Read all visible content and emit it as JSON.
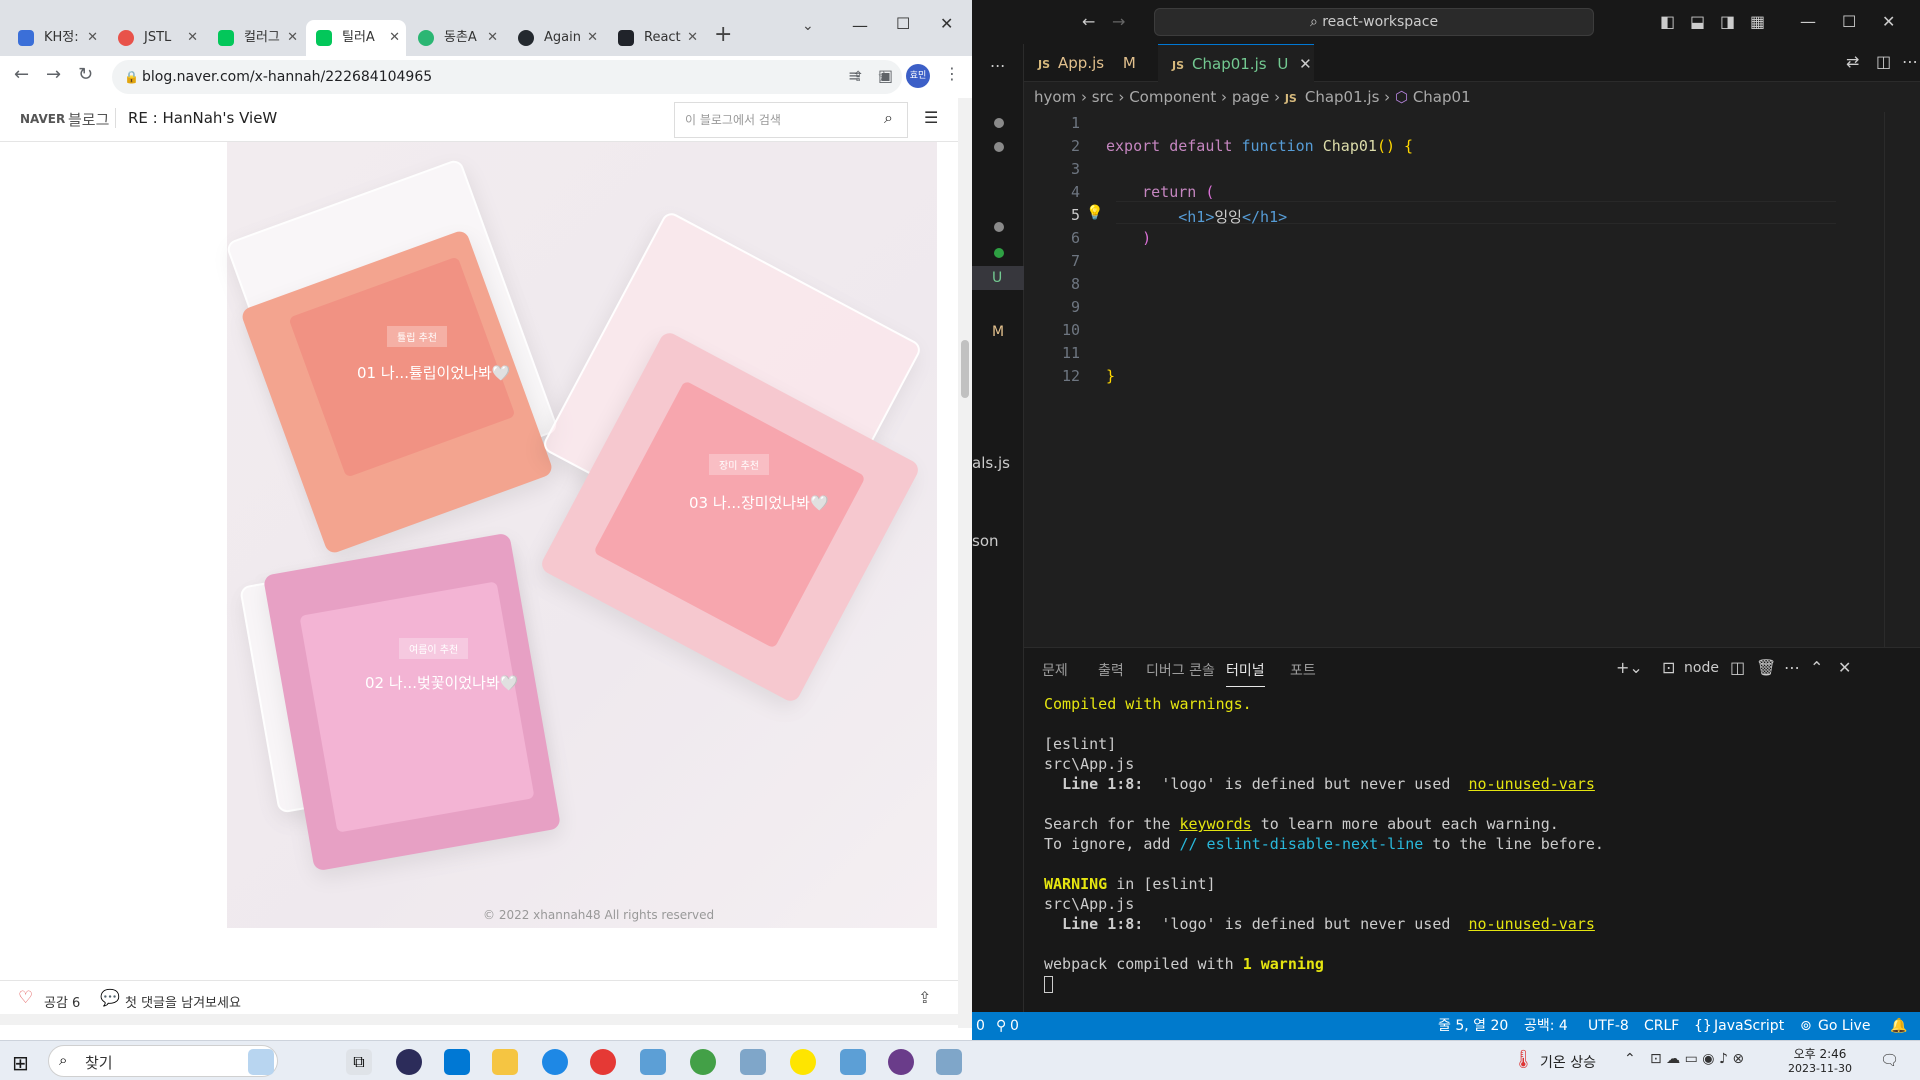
{
  "chrome": {
    "tabs": [
      {
        "label": "KH정:",
        "color": "#3b6fd8"
      },
      {
        "label": "JSTL",
        "color": "#e8524a"
      },
      {
        "label": "컬러그",
        "color": "#03c75a"
      },
      {
        "label": "틸러A",
        "color": "#03c75a"
      },
      {
        "label": "동촌A",
        "color": "#2bb673"
      },
      {
        "label": "Again",
        "color": "#24292f"
      },
      {
        "label": "React",
        "color": "#20232a"
      }
    ],
    "new_tab": "+",
    "url": "blog.naver.com/x-hannah/222684104965",
    "profile": "효민",
    "naver_logo": "NAVER",
    "blog_label": "블로그",
    "blog_title": "RE : HanNah's VieW",
    "search_placeholder": "이 블로그에서 검색",
    "photo": {
      "palette_1": {
        "badge": "튤립 추천",
        "title": "01 나...튤립이었나봐🤍"
      },
      "palette_2": {
        "badge": "여름이 추천",
        "title": "02 나...벚꽃이었나봐🤍"
      },
      "palette_3": {
        "badge": "장미 추천",
        "title": "03 나...장미었나봐🤍"
      },
      "copyright": "© 2022 xhannah48 All rights reserved"
    },
    "like_label": "공감 6",
    "comment_label": "첫 댓글을 남겨보세요"
  },
  "vscode": {
    "search": "react-workspace",
    "tabs": [
      {
        "label": "App.js",
        "badge": "M"
      },
      {
        "label": "Chap01.js",
        "badge": "U"
      }
    ],
    "breadcrumb": [
      "hyom",
      "src",
      "Component",
      "page",
      "Chap01.js",
      "Chap01"
    ],
    "line_numbers": [
      "1",
      "2",
      "3",
      "4",
      "5",
      "6",
      "7",
      "8",
      "9",
      "10",
      "11",
      "12"
    ],
    "current_line": "5",
    "code": {
      "l2_export": "export",
      "l2_default": "default",
      "l2_function": "function",
      "l2_name": "Chap01",
      "l2_paren": "()",
      "l2_brace": "{",
      "l4_return": "return",
      "l4_paren": "(",
      "l5_open": "<h1>",
      "l5_text": "잉잉",
      "l5_close": "</h1>",
      "l6_paren": ")",
      "l11_brace": "}"
    },
    "side_labels": {
      "u": "U",
      "m": "M",
      "als": "als.js",
      "son": "son",
      "dots": "..."
    },
    "panel_tabs": [
      "문제",
      "출력",
      "디버그 콘솔",
      "터미널",
      "포트"
    ],
    "panel_active": "터미널",
    "panel_node": "node",
    "terminal": {
      "compiled": "Compiled with warnings.",
      "eslint": "[eslint]",
      "file": "src\\App.js",
      "line_loc": "Line 1:8:",
      "warn_text": "'logo' is defined but never used",
      "rule": "no-unused-vars",
      "search_pre": "Search for the ",
      "keywords": "keywords",
      "search_post": " to learn more about each warning.",
      "ignore_pre": "To ignore, add ",
      "ignore_code": "// eslint-disable-next-line",
      "ignore_post": " to the line before.",
      "warning_label": "WARNING",
      "warning_in": " in [eslint]",
      "webpack_pre": "webpack compiled with ",
      "webpack_num": "1 warning"
    },
    "status": {
      "left_a": "0",
      "left_b": "0",
      "pos": "줄 5, 열 20",
      "spaces": "공백: 4",
      "enc": "UTF-8",
      "eol": "CRLF",
      "lang": "JavaScript",
      "golive": "Go Live"
    }
  },
  "taskbar": {
    "search": "찾기",
    "weather": "기온 상승",
    "time": "오후 2:46",
    "date": "2023-11-30"
  },
  "colors": {
    "accent": "#007acc",
    "naver_green": "#03c75a"
  }
}
